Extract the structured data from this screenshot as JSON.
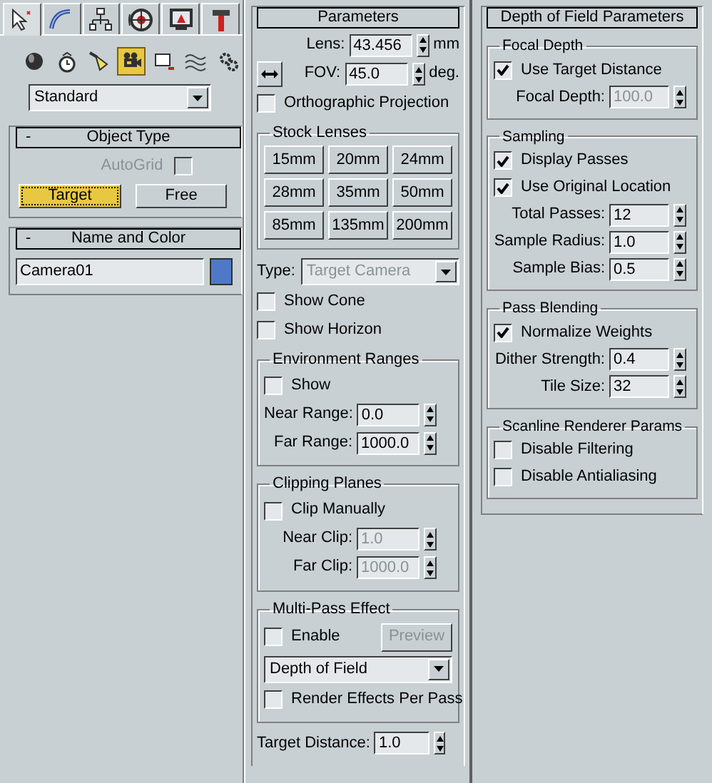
{
  "command_tabs": [
    {
      "selected": true
    },
    {
      "selected": false
    },
    {
      "selected": false
    },
    {
      "selected": false
    },
    {
      "selected": false
    },
    {
      "selected": false
    }
  ],
  "categories": [
    {
      "selected": false
    },
    {
      "selected": false
    },
    {
      "selected": false
    },
    {
      "selected": true
    },
    {
      "selected": false
    },
    {
      "selected": false
    },
    {
      "selected": false
    }
  ],
  "category_dropdown": "Standard",
  "object_type": {
    "collapse": "-",
    "title": "Object Type",
    "autogrid": {
      "label": "AutoGrid",
      "checked": false,
      "disabled": true
    },
    "buttons": [
      {
        "label": "Target",
        "selected": true
      },
      {
        "label": "Free",
        "selected": false
      }
    ]
  },
  "name_and_color": {
    "collapse": "-",
    "title": "Name and Color",
    "name": "Camera01",
    "color": "#4f78c8"
  },
  "parameters": {
    "title": "Parameters",
    "items": [
      {
        "kind": "spinner",
        "label": "Lens:",
        "value": "43.456",
        "units": "mm"
      },
      {
        "kind": "spinner",
        "label": "FOV:",
        "value": "45.0",
        "units": "deg.",
        "toggle": true
      },
      {
        "kind": "checkbox",
        "label": "Orthographic Projection",
        "checked": false
      },
      {
        "kind": "group",
        "title": "Stock Lenses",
        "items": [
          {
            "kind": "button_grid",
            "labels": [
              "15mm",
              "20mm",
              "24mm",
              "28mm",
              "35mm",
              "50mm",
              "85mm",
              "135mm",
              "200mm"
            ]
          }
        ]
      },
      {
        "kind": "dropdown",
        "label": "Type:",
        "value": "Target Camera",
        "disabled": true
      },
      {
        "kind": "checkbox",
        "label": "Show Cone",
        "checked": false
      },
      {
        "kind": "checkbox",
        "label": "Show Horizon",
        "checked": false
      },
      {
        "kind": "group",
        "title": "Environment Ranges",
        "items": [
          {
            "kind": "checkbox",
            "label": "Show",
            "checked": false
          },
          {
            "kind": "spinner",
            "label": "Near Range:",
            "value": "0.0"
          },
          {
            "kind": "spinner",
            "label": "Far Range:",
            "value": "1000.0"
          }
        ]
      },
      {
        "kind": "group",
        "title": "Clipping Planes",
        "items": [
          {
            "kind": "checkbox",
            "label": "Clip Manually",
            "checked": false
          },
          {
            "kind": "spinner",
            "label": "Near Clip:",
            "value": "1.0",
            "disabled": true
          },
          {
            "kind": "spinner",
            "label": "Far Clip:",
            "value": "1000.0",
            "disabled": true
          }
        ]
      },
      {
        "kind": "group",
        "title": "Multi-Pass Effect",
        "items": [
          {
            "kind": "checkbox",
            "label": "Enable",
            "checked": false,
            "button": {
              "label": "Preview",
              "disabled": true
            }
          },
          {
            "kind": "dropdown",
            "value": "Depth of Field",
            "disabled": false
          },
          {
            "kind": "checkbox",
            "label": "Render Effects Per Pass",
            "checked": false
          }
        ]
      },
      {
        "kind": "spinner",
        "label": "Target Distance:",
        "value": "1.0"
      }
    ]
  },
  "dof_parameters": {
    "title": "Depth of Field Parameters",
    "items": [
      {
        "kind": "group",
        "title": "Focal Depth",
        "items": [
          {
            "kind": "checkbox",
            "label": "Use Target Distance",
            "checked": true
          },
          {
            "kind": "spinner",
            "label": "Focal Depth:",
            "value": "100.0",
            "disabled": true
          }
        ]
      },
      {
        "kind": "group",
        "title": "Sampling",
        "items": [
          {
            "kind": "checkbox",
            "label": "Display Passes",
            "checked": true
          },
          {
            "kind": "checkbox",
            "label": "Use Original Location",
            "checked": true
          },
          {
            "kind": "spinner",
            "label": "Total Passes:",
            "value": "12"
          },
          {
            "kind": "spinner",
            "label": "Sample Radius:",
            "value": "1.0"
          },
          {
            "kind": "spinner",
            "label": "Sample Bias:",
            "value": "0.5"
          }
        ]
      },
      {
        "kind": "group",
        "title": "Pass Blending",
        "items": [
          {
            "kind": "checkbox",
            "label": "Normalize Weights",
            "checked": true
          },
          {
            "kind": "spinner",
            "label": "Dither Strength:",
            "value": "0.4"
          },
          {
            "kind": "spinner",
            "label": "Tile Size:",
            "value": "32"
          }
        ]
      },
      {
        "kind": "group",
        "title": "Scanline Renderer Params",
        "items": [
          {
            "kind": "checkbox",
            "label": "Disable Filtering",
            "checked": false
          },
          {
            "kind": "checkbox",
            "label": "Disable Antialiasing",
            "checked": false
          }
        ]
      }
    ]
  }
}
